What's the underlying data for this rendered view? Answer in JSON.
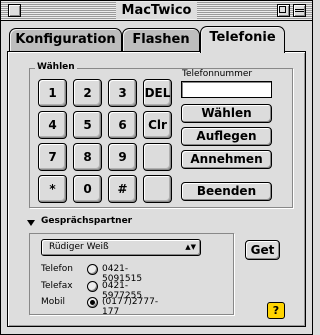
{
  "window": {
    "title": "MacTwico"
  },
  "tabs": [
    {
      "label": "Konfiguration"
    },
    {
      "label": "Flashen"
    },
    {
      "label": "Telefonie"
    }
  ],
  "dial": {
    "group_label": "Wählen",
    "keys": [
      "1",
      "2",
      "3",
      "DEL",
      "4",
      "5",
      "6",
      "Clr",
      "7",
      "8",
      "9",
      "",
      "*",
      "0",
      "#",
      ""
    ],
    "phone_label": "Telefonnummer",
    "phone_value": "",
    "buttons": {
      "dial": "Wählen",
      "hangup": "Auflegen",
      "accept": "Annehmen",
      "end": "Beenden"
    }
  },
  "partner": {
    "label": "Gesprächspartner",
    "selected_contact": "Rüdiger Weiß",
    "get_button": "Get",
    "numbers": [
      {
        "type": "Telefon",
        "number": "0421-5091515",
        "selected": false
      },
      {
        "type": "Telefax",
        "number": "0421-5977255",
        "selected": false
      },
      {
        "type": "Mobil",
        "number": "(0177)2777-177",
        "selected": true
      }
    ]
  },
  "help_icon": "question-mark-help-icon"
}
